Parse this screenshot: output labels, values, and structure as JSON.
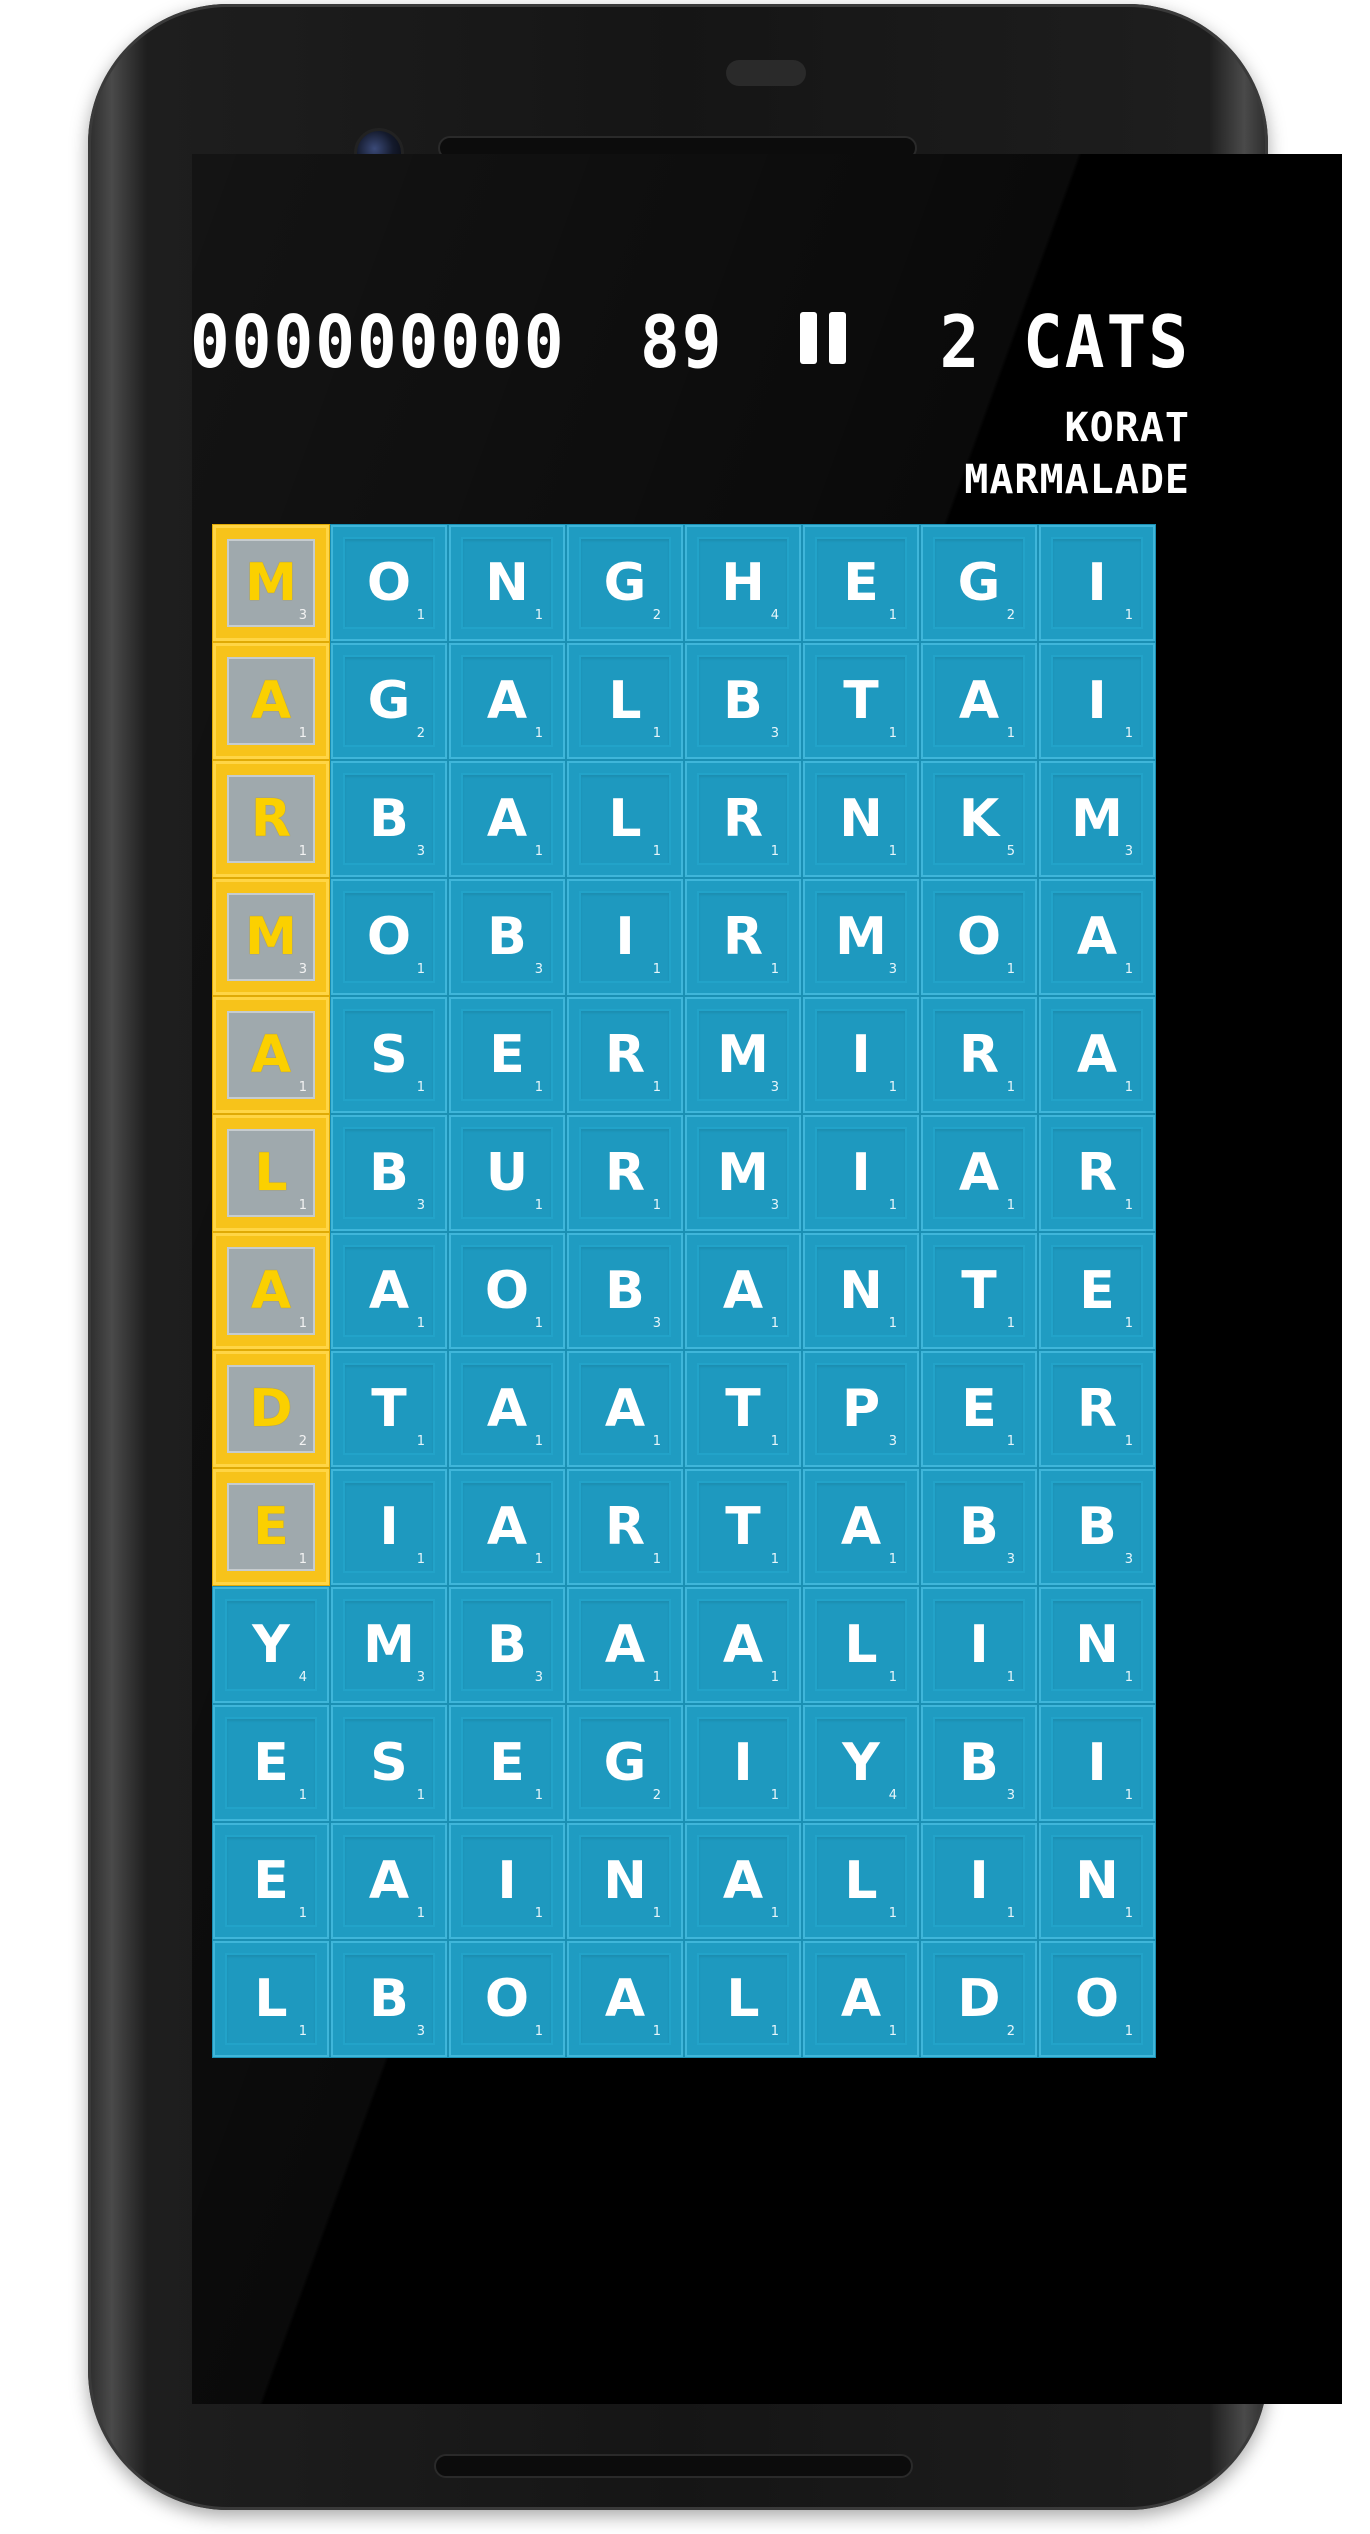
{
  "hud": {
    "score": "000000000",
    "timer": "89",
    "categories_count": "2 CATS",
    "found_words": [
      "KORAT",
      "MARMALADE"
    ]
  },
  "colors": {
    "tile": "#22a3c9",
    "selected_tile_border": "#f7c31a",
    "selected_letter": "#fbd000",
    "background": "#000000"
  },
  "board": {
    "rows": [
      [
        [
          "M",
          3
        ],
        [
          "O",
          1
        ],
        [
          "N",
          1
        ],
        [
          "G",
          2
        ],
        [
          "H",
          4
        ],
        [
          "E",
          1
        ],
        [
          "G",
          2
        ],
        [
          "I",
          1
        ]
      ],
      [
        [
          "A",
          1
        ],
        [
          "G",
          2
        ],
        [
          "A",
          1
        ],
        [
          "L",
          1
        ],
        [
          "B",
          3
        ],
        [
          "T",
          1
        ],
        [
          "A",
          1
        ],
        [
          "I",
          1
        ]
      ],
      [
        [
          "R",
          1
        ],
        [
          "B",
          3
        ],
        [
          "A",
          1
        ],
        [
          "L",
          1
        ],
        [
          "R",
          1
        ],
        [
          "N",
          1
        ],
        [
          "K",
          5
        ],
        [
          "M",
          3
        ]
      ],
      [
        [
          "M",
          3
        ],
        [
          "O",
          1
        ],
        [
          "B",
          3
        ],
        [
          "I",
          1
        ],
        [
          "R",
          1
        ],
        [
          "M",
          3
        ],
        [
          "O",
          1
        ],
        [
          "A",
          1
        ]
      ],
      [
        [
          "A",
          1
        ],
        [
          "S",
          1
        ],
        [
          "E",
          1
        ],
        [
          "R",
          1
        ],
        [
          "M",
          3
        ],
        [
          "I",
          1
        ],
        [
          "R",
          1
        ],
        [
          "A",
          1
        ]
      ],
      [
        [
          "L",
          1
        ],
        [
          "B",
          3
        ],
        [
          "U",
          1
        ],
        [
          "R",
          1
        ],
        [
          "M",
          3
        ],
        [
          "I",
          1
        ],
        [
          "A",
          1
        ],
        [
          "R",
          1
        ]
      ],
      [
        [
          "A",
          1
        ],
        [
          "A",
          1
        ],
        [
          "O",
          1
        ],
        [
          "B",
          3
        ],
        [
          "A",
          1
        ],
        [
          "N",
          1
        ],
        [
          "T",
          1
        ],
        [
          "E",
          1
        ]
      ],
      [
        [
          "D",
          2
        ],
        [
          "T",
          1
        ],
        [
          "A",
          1
        ],
        [
          "A",
          1
        ],
        [
          "T",
          1
        ],
        [
          "P",
          3
        ],
        [
          "E",
          1
        ],
        [
          "R",
          1
        ]
      ],
      [
        [
          "E",
          1
        ],
        [
          "I",
          1
        ],
        [
          "A",
          1
        ],
        [
          "R",
          1
        ],
        [
          "T",
          1
        ],
        [
          "A",
          1
        ],
        [
          "B",
          3
        ],
        [
          "B",
          3
        ]
      ],
      [
        [
          "Y",
          4
        ],
        [
          "M",
          3
        ],
        [
          "B",
          3
        ],
        [
          "A",
          1
        ],
        [
          "A",
          1
        ],
        [
          "L",
          1
        ],
        [
          "I",
          1
        ],
        [
          "N",
          1
        ]
      ],
      [
        [
          "E",
          1
        ],
        [
          "S",
          1
        ],
        [
          "E",
          1
        ],
        [
          "G",
          2
        ],
        [
          "I",
          1
        ],
        [
          "Y",
          4
        ],
        [
          "B",
          3
        ],
        [
          "I",
          1
        ]
      ],
      [
        [
          "E",
          1
        ],
        [
          "A",
          1
        ],
        [
          "I",
          1
        ],
        [
          "N",
          1
        ],
        [
          "A",
          1
        ],
        [
          "L",
          1
        ],
        [
          "I",
          1
        ],
        [
          "N",
          1
        ]
      ],
      [
        [
          "L",
          1
        ],
        [
          "B",
          3
        ],
        [
          "O",
          1
        ],
        [
          "A",
          1
        ],
        [
          "L",
          1
        ],
        [
          "A",
          1
        ],
        [
          "D",
          2
        ],
        [
          "O",
          1
        ]
      ]
    ],
    "selected_word": "MARMALADE",
    "selected_column": 0,
    "selected_row_count": 9
  }
}
